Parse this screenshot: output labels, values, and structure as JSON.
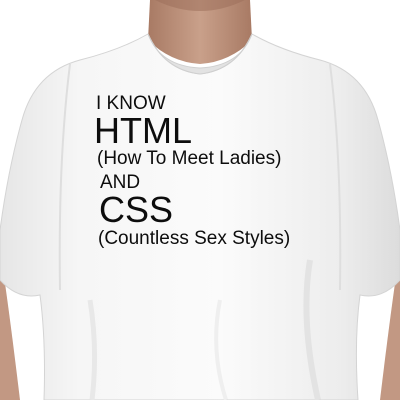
{
  "shirt_print": {
    "line1": "I KNOW",
    "line2": "HTML",
    "line3": "(How To Meet Ladies)",
    "line4": "AND",
    "line5": "CSS",
    "line6": "(Countless Sex Styles)"
  },
  "colors": {
    "background": "#ffffff",
    "shirt": "#f3f3f3",
    "shirt_shadow": "#d9d9d9",
    "skin": "#c59a84",
    "skin_shadow": "#a87a64",
    "print_ink": "#0d0d0d"
  }
}
